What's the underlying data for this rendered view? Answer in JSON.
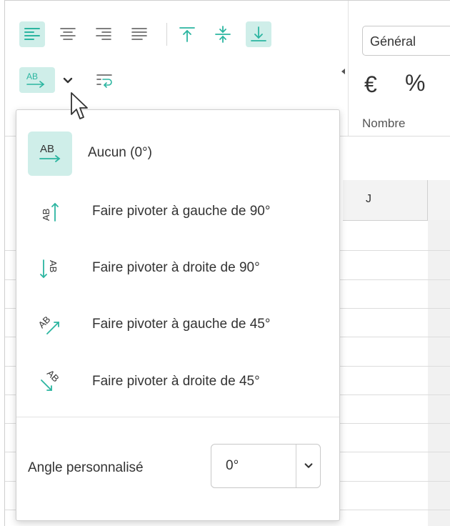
{
  "toolbar": {
    "alignment_buttons": [
      {
        "name": "align-left",
        "active": true
      },
      {
        "name": "align-center",
        "active": false
      },
      {
        "name": "align-right",
        "active": false
      },
      {
        "name": "align-justify",
        "active": false
      },
      {
        "name": "align-top",
        "active": false
      },
      {
        "name": "align-middle",
        "active": false
      },
      {
        "name": "align-bottom",
        "active": true
      }
    ],
    "orientation_button": {
      "label": "AB",
      "active": true
    },
    "wrap_text_button": {
      "active": false
    },
    "number_format": {
      "value": "Général"
    },
    "currency_symbol": "€",
    "percent_symbol": "%",
    "number_section_label": "Nombre"
  },
  "sheet": {
    "column_j_label": "J"
  },
  "orientation_menu": {
    "items": [
      {
        "icon": "text-horizontal-icon",
        "label": "Aucun (0°)",
        "selected": true
      },
      {
        "icon": "rotate-left-90-icon",
        "label": "Faire pivoter à gauche de 90°",
        "selected": false
      },
      {
        "icon": "rotate-right-90-icon",
        "label": "Faire pivoter à droite de 90°",
        "selected": false
      },
      {
        "icon": "rotate-left-45-icon",
        "label": "Faire pivoter à gauche de 45°",
        "selected": false
      },
      {
        "icon": "rotate-right-45-icon",
        "label": "Faire pivoter à droite de 45°",
        "selected": false
      }
    ],
    "custom_angle": {
      "label": "Angle personnalisé",
      "value": "0°"
    }
  },
  "colors": {
    "accent": "#2bb5a0",
    "active_bg": "#cfeee9",
    "text": "#333333"
  }
}
